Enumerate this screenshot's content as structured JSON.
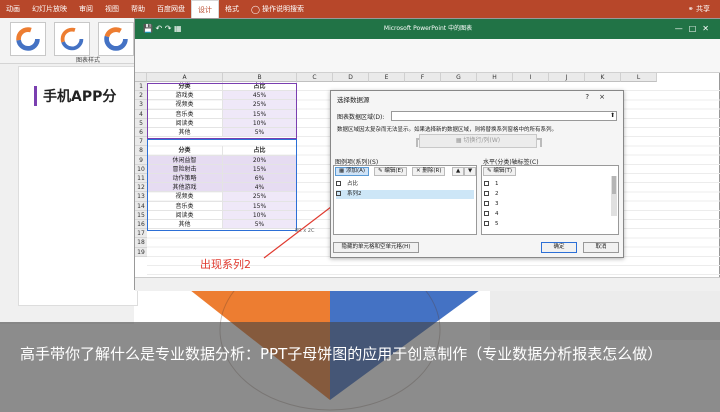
{
  "ribbon": {
    "tabs": [
      "动画",
      "幻灯片放映",
      "审阅",
      "视图",
      "帮助",
      "百度网盘",
      "设计",
      "格式"
    ],
    "active_tab": "设计",
    "tell_me": "操作说明搜索",
    "share": "共享"
  },
  "toolbar": {
    "caption": "图表样式"
  },
  "slide": {
    "title": "手机APP分"
  },
  "excel": {
    "title": "Microsoft PowerPoint 中的图表",
    "columns": [
      "A",
      "B",
      "C",
      "D",
      "E",
      "F",
      "G",
      "H",
      "I",
      "J",
      "K",
      "L"
    ],
    "rows": [
      "1",
      "2",
      "3",
      "4",
      "5",
      "6",
      "7",
      "8",
      "9",
      "10",
      "11",
      "12",
      "13",
      "14",
      "15",
      "16",
      "17",
      "18",
      "19"
    ],
    "table1": [
      [
        "分类",
        "占比"
      ],
      [
        "游戏类",
        "45%"
      ],
      [
        "视频类",
        "25%"
      ],
      [
        "音乐类",
        "15%"
      ],
      [
        "阅读类",
        "10%"
      ],
      [
        "其他",
        "5%"
      ]
    ],
    "table2": [
      [
        "分类",
        "占比"
      ],
      [
        "休闲益智",
        "20%"
      ],
      [
        "冒险射击",
        "15%"
      ],
      [
        "动作策略",
        "6%"
      ],
      [
        "其他游戏",
        "4%"
      ],
      [
        "视频类",
        "25%"
      ],
      [
        "音乐类",
        "15%"
      ],
      [
        "阅读类",
        "10%"
      ],
      [
        "其他",
        "5%"
      ]
    ],
    "fill_handle": "8R x 2C"
  },
  "dialog": {
    "title": "选择数据源",
    "help": "?",
    "close": "×",
    "range_label": "图表数据区域(D):",
    "note": "数据区域因太复杂而无法显示。如果选择新的数据区域，则将替换系列窗格中的所有系列。",
    "switch_btn": "切换行/列(W)",
    "legend_label": "图例项(系列)(S)",
    "axis_label": "水平(分类)轴标签(C)",
    "add_btn": "添加(A)",
    "edit_btn": "编辑(E)",
    "delete_btn": "删除(R)",
    "axis_edit_btn": "编辑(T)",
    "series": [
      "占比",
      "系列2"
    ],
    "axis_items": [
      "1",
      "2",
      "3",
      "4",
      "5"
    ],
    "hidden_btn": "隐藏的单元格和空单元格(H)",
    "ok_btn": "确定",
    "cancel_btn": "取消"
  },
  "annotation": "出现系列2",
  "banner": "高手带你了解什么是专业数据分析：PPT子母饼图的应用于创意制作（专业数据分析报表怎么做）",
  "colors": {
    "ribbon": "#b7472a",
    "excel_title": "#217346",
    "annotation": "#e03a2f",
    "pie_orange": "#ed7d31",
    "pie_blue": "#4472c4"
  }
}
